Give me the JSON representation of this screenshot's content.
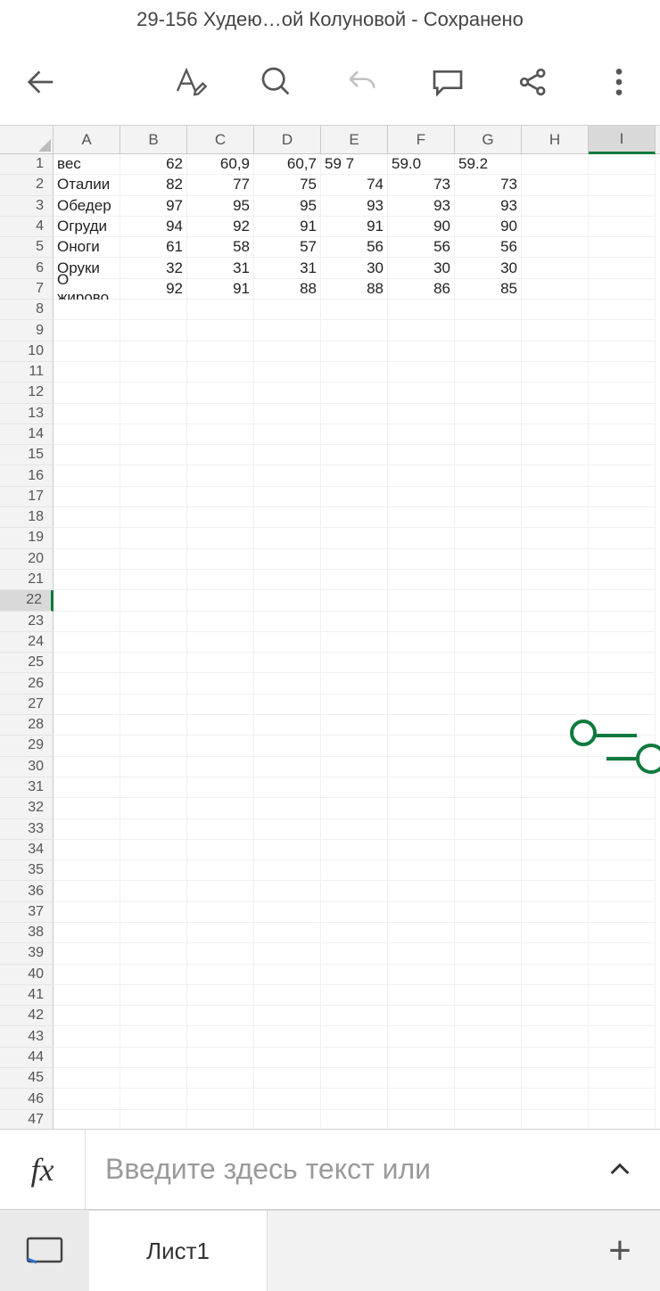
{
  "title": "29-156 Худею…ой Колуновой - Сохранено",
  "columns": [
    "A",
    "B",
    "C",
    "D",
    "E",
    "F",
    "G",
    "H",
    "I"
  ],
  "selected_column_index": 8,
  "row_count": 47,
  "selected_row": 22,
  "cells": {
    "r1": {
      "A": "вес",
      "B": "62",
      "C": "60,9",
      "D": "60,7",
      "E": "59 7",
      "F": "59.0",
      "G": "59.2"
    },
    "r2": {
      "A": "Оталии",
      "B": "82",
      "C": "77",
      "D": "75",
      "E": "74",
      "F": "73",
      "G": "73"
    },
    "r3": {
      "A": "Обедер",
      "B": "97",
      "C": "95",
      "D": "95",
      "E": "93",
      "F": "93",
      "G": "93"
    },
    "r4": {
      "A": "Огруди",
      "B": "94",
      "C": "92",
      "D": "91",
      "E": "91",
      "F": "90",
      "G": "90"
    },
    "r5": {
      "A": "Оноги",
      "B": "61",
      "C": "58",
      "D": "57",
      "E": "56",
      "F": "56",
      "G": "56"
    },
    "r6": {
      "A": "Оруки",
      "B": "32",
      "C": "31",
      "D": "31",
      "E": "30",
      "F": "30",
      "G": "30"
    },
    "r7": {
      "A": "О жирово",
      "B": "92",
      "C": "91",
      "D": "88",
      "E": "88",
      "F": "86",
      "G": "85"
    }
  },
  "text_columns": [
    "A",
    "E",
    "F",
    "G"
  ],
  "fx": {
    "placeholder": "Введите здесь текст или"
  },
  "sheet": {
    "active": "Лист1"
  }
}
